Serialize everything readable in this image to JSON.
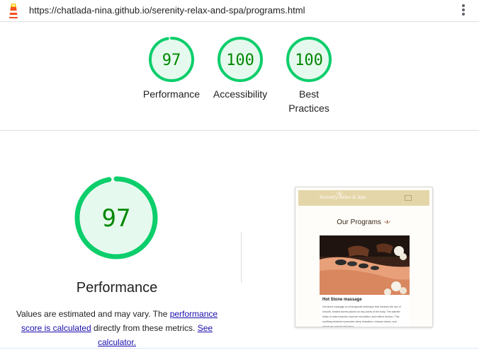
{
  "address_bar": {
    "url": "https://chatlada-nina.github.io/serenity-relax-and-spa/programs.html"
  },
  "summary_gauges": [
    {
      "score": "97",
      "label": "Performance",
      "fraction": 0.97
    },
    {
      "score": "100",
      "label": "Accessibility",
      "fraction": 1.0
    },
    {
      "score": "100",
      "label_line1": "Best",
      "label_line2": "Practices",
      "fraction": 1.0
    }
  ],
  "performance_panel": {
    "score": "97",
    "fraction": 0.97,
    "title": "Performance",
    "note_text1": "Values are estimated and may vary. The ",
    "note_link1": "performance score is calculated",
    "note_text2": " directly from these metrics. ",
    "note_link2": "See calculator."
  },
  "screenshot_preview": {
    "heading": "Our Programs",
    "card_title": "Hot Stone massage",
    "card_text": "Hot stone massage is a therapeutic technique that involves the use of smooth, heated stones placed on key points of the body. The warmth helps to relax muscles, improve circulation, and relieve tension. This soothing treatment promotes deep relaxation, reduces stress, and enhances overall well-being."
  },
  "colors": {
    "pass_green": "#0cce6b",
    "pass_text": "#008800",
    "pass_fill": "#e6f9ee",
    "link": "#1a0dab"
  },
  "icons": [
    "lighthouse-logo-icon",
    "more-vert-icon",
    "lotus-icon"
  ]
}
